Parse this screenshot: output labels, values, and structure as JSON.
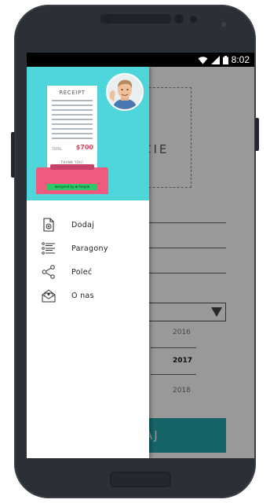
{
  "status_bar": {
    "time": "8:02"
  },
  "background_screen": {
    "box_text": "CIE",
    "years": [
      "2016",
      "2017",
      "2018"
    ],
    "selected_year": "2017",
    "button_label": "AJ"
  },
  "drawer": {
    "header": {
      "receipt_title": "RECEIPT",
      "receipt_total_label": "TOTAL",
      "receipt_total": "$700",
      "receipt_thanks": "THANK YOU!",
      "printer_tag": "designed by ❀ freepik"
    },
    "menu": [
      {
        "label": "Dodaj",
        "icon": "add-receipt-icon"
      },
      {
        "label": "Paragony",
        "icon": "receipt-list-icon"
      },
      {
        "label": "Poleć",
        "icon": "share-icon"
      },
      {
        "label": "O nas",
        "icon": "envelope-icon"
      }
    ]
  },
  "colors": {
    "drawer_header": "#4fd6db",
    "accent_pink": "#ef5a7e",
    "total_red": "#e53e5b",
    "background_button": "#23a9ae",
    "phone_frame": "#2b2f36"
  }
}
